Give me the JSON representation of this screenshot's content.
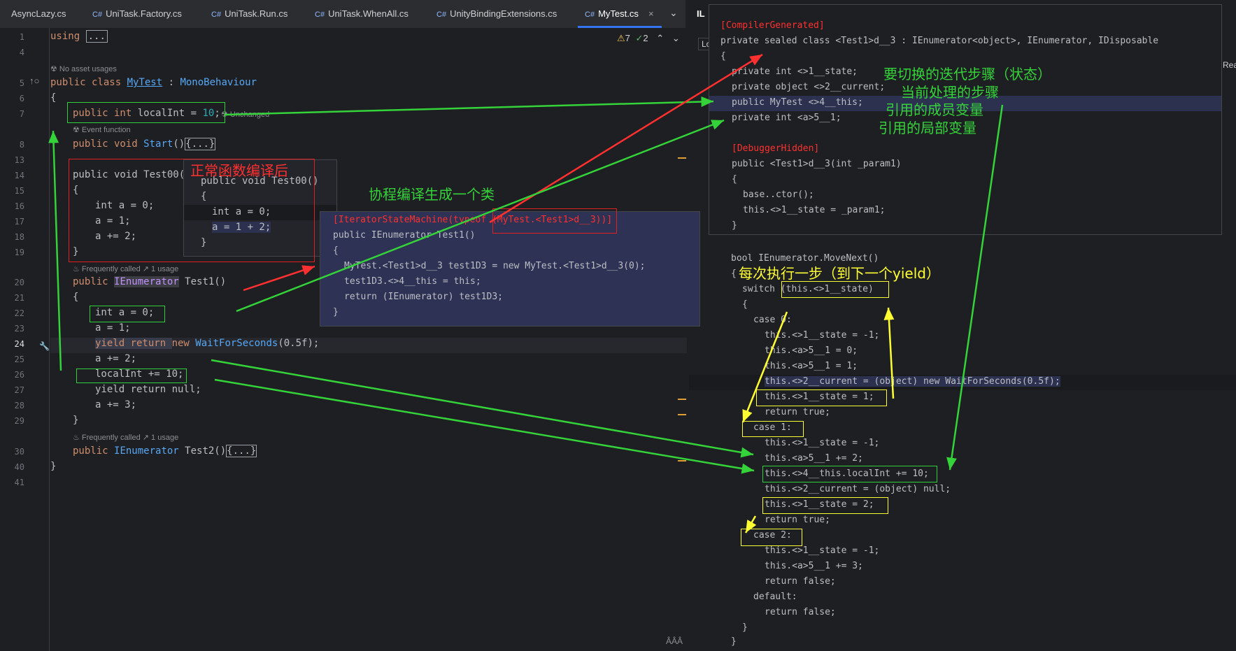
{
  "tabs": [
    {
      "icon": "",
      "label": "AsyncLazy.cs"
    },
    {
      "icon": "C#",
      "label": "UniTask.Factory.cs"
    },
    {
      "icon": "C#",
      "label": "UniTask.Run.cs"
    },
    {
      "icon": "C#",
      "label": "UniTask.WhenAll.cs"
    },
    {
      "icon": "C#",
      "label": "UnityBindingExtensions.cs"
    },
    {
      "icon": "C#",
      "label": "MyTest.cs",
      "close": "×",
      "active": true
    }
  ],
  "tab_more": "⌄",
  "right_header": "IL",
  "right_header_side": "Rea",
  "right_lo": "Lo",
  "status": {
    "warnings": "7",
    "checks": "2"
  },
  "line_numbers": [
    "1",
    "4",
    "5",
    "6",
    "7",
    "8",
    "13",
    "14",
    "15",
    "16",
    "17",
    "18",
    "19",
    "20",
    "21",
    "22",
    "23",
    "24",
    "25",
    "26",
    "27",
    "28",
    "29",
    "30",
    "40",
    "41"
  ],
  "editor": {
    "l1": "using",
    "l1_fold": "...",
    "hint_no_asset": "No asset usages",
    "l5_a": "public class ",
    "l5_b": "MyTest",
    "l5_c": " : ",
    "l5_d": "MonoBehaviour",
    "l6": "{",
    "l7_a": "public int ",
    "l7_b": "localInt",
    "l7_c": " = ",
    "l7_d": "10",
    "l7_e": ";",
    "hint_unchanged": "Unchanged",
    "hint_event": "Event function",
    "l8_a": "public void ",
    "l8_b": "Start",
    "l8_c": "()",
    "l8_fold": "{...}",
    "l14": "public void Test00()",
    "l15": "{",
    "l16": "int a = 0;",
    "l17": "a = 1;",
    "l18": "a += 2;",
    "l19": "}",
    "hint_freq1": "Frequently called",
    "hint_usage1": "1 usage",
    "l20_a": "public ",
    "l20_b": "IEnumerator",
    "l20_c": " Test1()",
    "l21": "{",
    "l22": "int a = 0;",
    "l23": "a = 1;",
    "l24_a": "yield return ",
    "l24_b": "new ",
    "l24_c": "WaitForSeconds",
    "l24_d": "(0.5f);",
    "l25": "a += 2;",
    "l26": "localInt += 10;",
    "l27": "yield return null;",
    "l28": "a += 3;",
    "l29": "}",
    "hint_freq2": "Frequently called",
    "hint_usage2": "1 usage",
    "l30_a": "public ",
    "l30_b": "IEnumerator",
    "l30_c": " Test2()",
    "l30_fold": "{...}",
    "l40": "}"
  },
  "popup1": {
    "l1": "public void Test00()",
    "l2": "{",
    "l3": "int a = 0;",
    "l4": "a = 1 + 2;",
    "l5": "}"
  },
  "popup2": {
    "l1": "[IteratorStateMachine(typeof (MyTest.<Test1>d__3))]",
    "l2": "public IEnumerator Test1()",
    "l3": "{",
    "l4": "MyTest.<Test1>d__3 test1D3 = new MyTest.<Test1>d__3(0);",
    "l5": "test1D3.<>4__this = this;",
    "l6": "return (IEnumerator) test1D3;",
    "l7": "}"
  },
  "il": {
    "l1": "[CompilerGenerated]",
    "l2": "private sealed class <Test1>d__3 : IEnumerator<object>, IEnumerator, IDisposable",
    "l3": "{",
    "l4": "private int <>1__state;",
    "l5": "private object <>2__current;",
    "l6": "public MyTest <>4__this;",
    "l7": "private int <a>5__1;",
    "l8": "[DebuggerHidden]",
    "l9": "public <Test1>d__3(int _param1)",
    "l10": "{",
    "l11": "base..ctor();",
    "l12": "this.<>1__state = _param1;",
    "l13": "}",
    "l14": "bool IEnumerator.MoveNext()",
    "l15": "{",
    "l16": "switch (this.<>1__state)",
    "l17": "{",
    "l18": "case 0:",
    "l19": "this.<>1__state = -1;",
    "l20": "this.<a>5__1 = 0;",
    "l21": "this.<a>5__1 = 1;",
    "l22": "this.<>2__current = (object) new WaitForSeconds(0.5f);",
    "l23": "this.<>1__state = 1;",
    "l24": "return true;",
    "l25": "case 1:",
    "l26": "this.<>1__state = -1;",
    "l27": "this.<a>5__1 += 2;",
    "l28": "this.<>4__this.localInt += 10;",
    "l29": "this.<>2__current = (object) null;",
    "l30": "this.<>1__state = 2;",
    "l31": "return true;",
    "l32": "case 2:",
    "l33": "this.<>1__state = -1;",
    "l34": "this.<a>5__1 += 3;",
    "l35": "return false;",
    "l36": "default:",
    "l37": "return false;",
    "l38": "}",
    "l39": "}"
  },
  "annotations": {
    "normal_compiled": "正常函数编译后",
    "coroutine_class": "协程编译生成一个类",
    "state_to_switch": "要切换的迭代步骤（状态）",
    "current_step": "当前处理的步骤",
    "member_ref": "引用的成员变量",
    "local_ref": "引用的局部变量",
    "each_step": "每次执行一步（到下一个yield）"
  },
  "colors": {
    "green": "#35d33a",
    "red": "#ff3030",
    "yellow": "#ffff33"
  }
}
